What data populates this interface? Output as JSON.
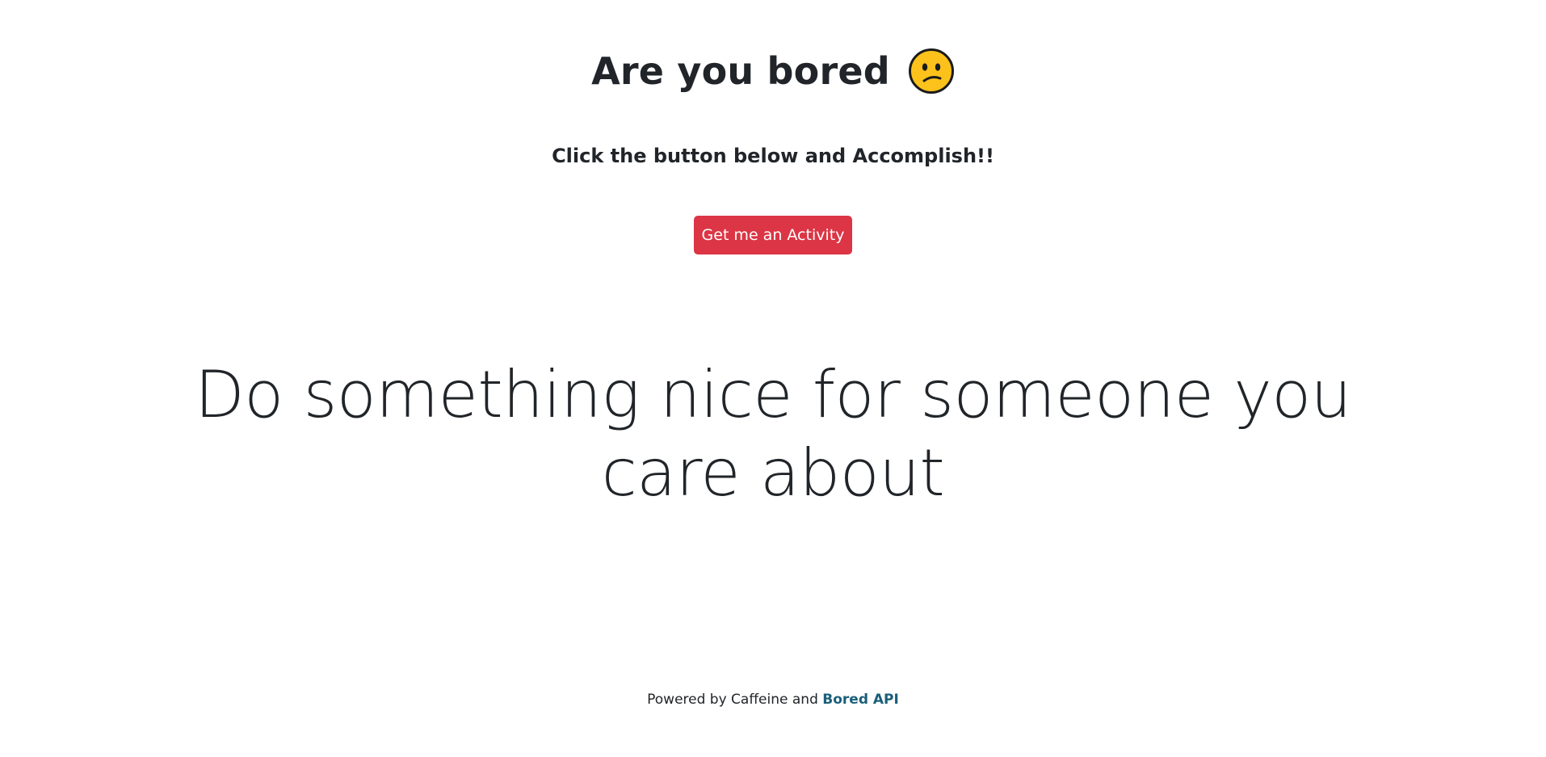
{
  "header": {
    "title": "Are you bored",
    "emoji_icon": "confused-face-icon"
  },
  "subtitle": "Click the button below and Accomplish!!",
  "action_button": {
    "label": "Get me an Activity",
    "color": "#dc3545"
  },
  "activity": {
    "text": "Do something nice for someone you care about"
  },
  "footer": {
    "prefix": "Powered by Caffeine and",
    "link_label": "Bored API",
    "link_color": "#1a5f7a"
  }
}
